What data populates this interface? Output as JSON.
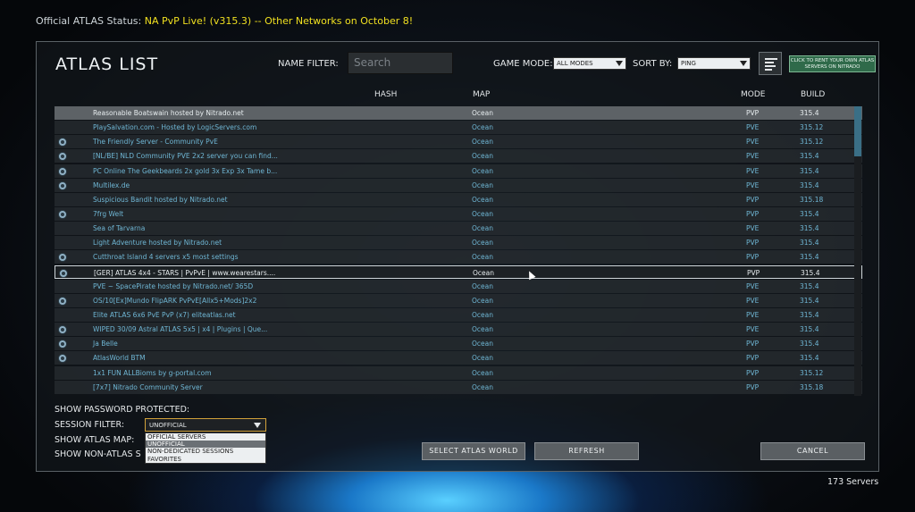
{
  "status": {
    "prefix": "Official ATLAS Status: ",
    "highlight": "NA PvP Live! (v315.3) -- Other Networks on October 8!"
  },
  "header": {
    "title": "ATLAS LIST",
    "name_filter_label": "NAME FILTER:",
    "name_filter_placeholder": "Search",
    "game_mode_label": "GAME MODE:",
    "game_mode_value": "ALL MODES",
    "sort_by_label": "SORT BY:",
    "sort_by_value": "PING",
    "rent_button": "CLICK TO RENT YOUR OWN ATLAS SERVERS ON NITRADO"
  },
  "columns": {
    "hash": "HASH",
    "map": "MAP",
    "mode": "MODE",
    "build": "BUILD"
  },
  "servers": [
    {
      "name": "Reasonable Boatswain hosted by Nitrado.net",
      "map": "Ocean",
      "mode": "PVP",
      "build": "315.4",
      "icon": false
    },
    {
      "name": "PlaySalvation.com - Hosted by LogicServers.com",
      "map": "Ocean",
      "mode": "PVE",
      "build": "315.12",
      "icon": false
    },
    {
      "name": "The Friendly Server - Community PvE",
      "map": "Ocean",
      "mode": "PVE",
      "build": "315.12",
      "icon": true
    },
    {
      "name": "[NL/BE] NLD Community PVE 2x2 server you can find...",
      "map": "Ocean",
      "mode": "PVE",
      "build": "315.4",
      "icon": true
    },
    {
      "name": "PC Online The Geekbeards 2x gold 3x Exp 3x Tame b...",
      "map": "Ocean",
      "mode": "PVE",
      "build": "315.4",
      "icon": true
    },
    {
      "name": "Multilex.de",
      "map": "Ocean",
      "mode": "PVE",
      "build": "315.4",
      "icon": true
    },
    {
      "name": "Suspicious Bandit hosted by Nitrado.net",
      "map": "Ocean",
      "mode": "PVP",
      "build": "315.18",
      "icon": false
    },
    {
      "name": "7frg Welt",
      "map": "Ocean",
      "mode": "PVP",
      "build": "315.4",
      "icon": true
    },
    {
      "name": "Sea of Tarvarna",
      "map": "Ocean",
      "mode": "PVE",
      "build": "315.4",
      "icon": false
    },
    {
      "name": "Light Adventure hosted by Nitrado.net",
      "map": "Ocean",
      "mode": "PVP",
      "build": "315.4",
      "icon": false
    },
    {
      "name": "Cutthroat Island 4 servers x5 most settings",
      "map": "Ocean",
      "mode": "PVP",
      "build": "315.4",
      "icon": true
    },
    {
      "name": "[GER] ATLAS 4x4 - STARS | PvPvE | www.wearestars....",
      "map": "Ocean",
      "mode": "PVP",
      "build": "315.4",
      "icon": true
    },
    {
      "name": "PVE ~ SpacePirate hosted by Nitrado.net/ 365D",
      "map": "Ocean",
      "mode": "PVE",
      "build": "315.4",
      "icon": false
    },
    {
      "name": "OS/10[Ex]Mundo FlipARK PvPvE[Allx5+Mods]2x2",
      "map": "Ocean",
      "mode": "PVE",
      "build": "315.4",
      "icon": true
    },
    {
      "name": "Elite ATLAS 6x6 PvE PvP (x7) eliteatlas.net",
      "map": "Ocean",
      "mode": "PVE",
      "build": "315.4",
      "icon": false
    },
    {
      "name": "WIPED 30/09 Astral ATLAS 5x5 | x4 | Plugins | Que...",
      "map": "Ocean",
      "mode": "PVE",
      "build": "315.4",
      "icon": true
    },
    {
      "name": "Ja Belle",
      "map": "Ocean",
      "mode": "PVP",
      "build": "315.4",
      "icon": true
    },
    {
      "name": "AtlasWorld BTM",
      "map": "Ocean",
      "mode": "PVP",
      "build": "315.4",
      "icon": true
    },
    {
      "name": "1x1 FUN ALLBioms by g-portal.com",
      "map": "Ocean",
      "mode": "PVP",
      "build": "315.12",
      "icon": false
    },
    {
      "name": "[7x7] Nitrado Community Server",
      "map": "Ocean",
      "mode": "PVP",
      "build": "315.18",
      "icon": false
    }
  ],
  "options": {
    "show_password_protected": "SHOW PASSWORD PROTECTED:",
    "session_filter": "SESSION FILTER:",
    "session_filter_value": "UNOFFICIAL",
    "show_atlas_map": "SHOW ATLAS MAP:",
    "show_non_atlas": "SHOW NON-ATLAS S",
    "session_options": [
      "OFFICIAL SERVERS",
      "UNOFFICIAL",
      "NON-DEDICATED SESSIONS",
      "FAVORITES"
    ]
  },
  "buttons": {
    "select_world": "SELECT ATLAS WORLD",
    "refresh": "REFRESH",
    "cancel": "CANCEL"
  },
  "footer": {
    "server_count": "173 Servers"
  },
  "colors": {
    "accent": "#f0e020",
    "row_text": "#6fb6d4",
    "rent_bg": "#2f6a4a"
  }
}
